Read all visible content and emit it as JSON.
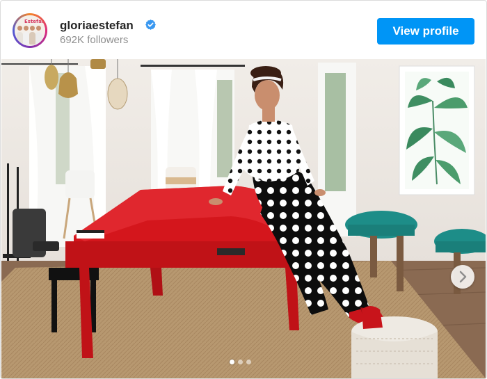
{
  "post": {
    "username": "gloriaestefan",
    "followers": "692K followers",
    "view_profile_label": "View profile",
    "avatar_text": "Estefan",
    "carousel": {
      "count": 3,
      "active_index": 0
    }
  },
  "colors": {
    "accent_button": "#0095f6",
    "piano_red": "#d4161c",
    "username_text": "#262626",
    "secondary_text": "#8e8e8e",
    "verified_badge": "#3897f0"
  },
  "icons": {
    "verified": "verified-badge-icon",
    "next": "chevron-right-icon"
  }
}
